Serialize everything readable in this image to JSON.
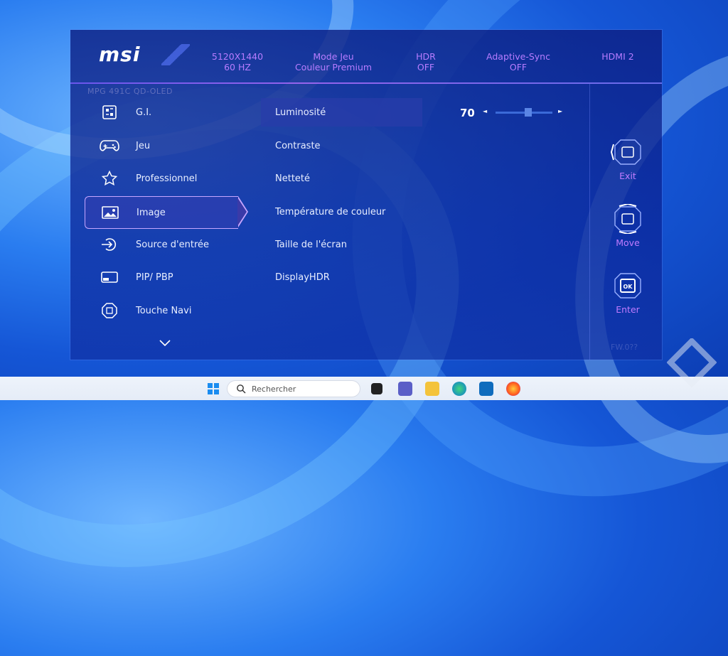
{
  "brand": {
    "logo": "msi"
  },
  "status_bar": [
    {
      "line1": "5120X1440",
      "line2": "60 HZ"
    },
    {
      "line1": "Mode Jeu",
      "line2": "Couleur Premium"
    },
    {
      "line1": "HDR",
      "line2": "OFF"
    },
    {
      "line1": "Adaptive-Sync",
      "line2": "OFF"
    },
    {
      "line1": "HDMI 2",
      "line2": ""
    }
  ],
  "model": "MPG 491C QD-OLED",
  "menu": [
    {
      "label": "G.I.",
      "icon": "gaming-intelligence-icon"
    },
    {
      "label": "Jeu",
      "icon": "gamepad-icon"
    },
    {
      "label": "Professionnel",
      "icon": "star-icon"
    },
    {
      "label": "Image",
      "icon": "image-icon",
      "active": true
    },
    {
      "label": "Source d'entrée",
      "icon": "input-source-icon"
    },
    {
      "label": "PIP/ PBP",
      "icon": "pip-icon"
    },
    {
      "label": "Touche Navi",
      "icon": "navi-key-icon"
    }
  ],
  "submenu": [
    {
      "label": "Luminosité",
      "selected": true
    },
    {
      "label": "Contraste"
    },
    {
      "label": "Netteté"
    },
    {
      "label": "Température de couleur"
    },
    {
      "label": "Taille de l'écran"
    },
    {
      "label": "DisplayHDR"
    }
  ],
  "brightness": {
    "value": "70",
    "level": 0.58
  },
  "controls": [
    {
      "label": "Exit",
      "icon": "exit-joystick-icon"
    },
    {
      "label": "Move",
      "icon": "move-joystick-icon"
    },
    {
      "label": "Enter",
      "icon": "enter-joystick-icon"
    }
  ],
  "firmware": "FW.0??",
  "taskbar": {
    "search_placeholder": "Rechercher"
  },
  "colors": {
    "accent": "#c07bff",
    "divider": "#b46dff",
    "selected_row": "#283caa"
  }
}
